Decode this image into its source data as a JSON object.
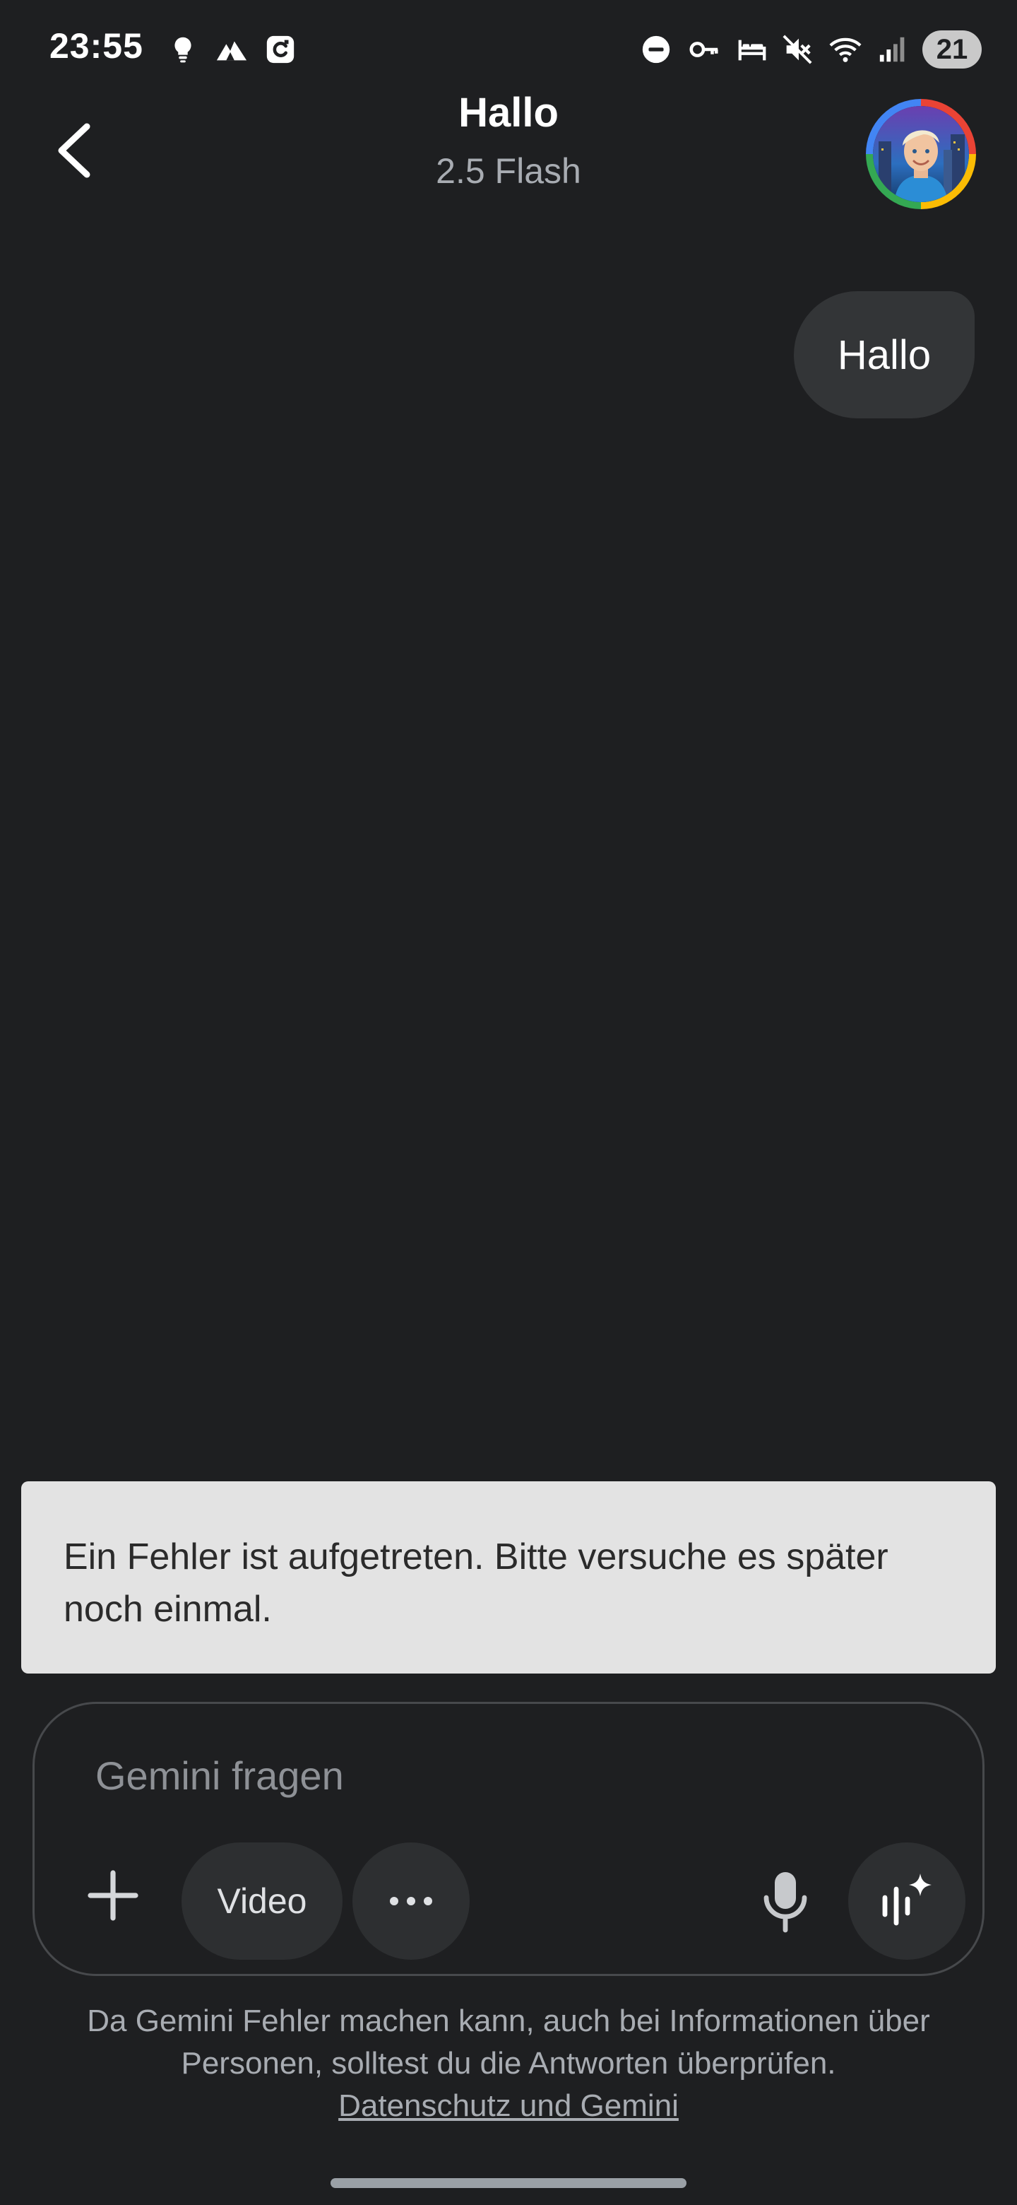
{
  "status_bar": {
    "time": "23:55",
    "left_icons": [
      "lightbulb-icon",
      "mountain-app-icon",
      "g-app-icon"
    ],
    "right_icons": [
      "do-not-disturb-icon",
      "vpn-key-icon",
      "bed-icon",
      "mute-icon",
      "wifi-icon",
      "signal-icon"
    ],
    "battery": "21"
  },
  "header": {
    "title": "Hallo",
    "subtitle": "2.5 Flash",
    "back_icon": "chevron-left-icon",
    "avatar_ring_colors": [
      "#ea4335",
      "#fbbc04",
      "#34a853",
      "#4285f4"
    ]
  },
  "conversation": {
    "user_message": "Hallo"
  },
  "snackbar": {
    "message": "Ein Fehler ist aufgetreten. Bitte versuche es später noch einmal."
  },
  "input": {
    "placeholder": "Gemini fragen",
    "value": "",
    "add_icon": "plus-icon",
    "video_chip": "Video",
    "more_icon": "more-dots-icon",
    "mic_icon": "microphone-icon",
    "live_icon": "live-sparkle-icon"
  },
  "footer": {
    "disclaimer": "Da Gemini Fehler machen kann, auch bei Informationen über Personen, solltest du die Antworten überprüfen.",
    "privacy_link": "Datenschutz und Gemini"
  },
  "colors": {
    "background": "#1e1f21",
    "bubble": "#333537",
    "snackbar_bg": "#e3e3e3",
    "chip_bg": "#2d2f31"
  }
}
